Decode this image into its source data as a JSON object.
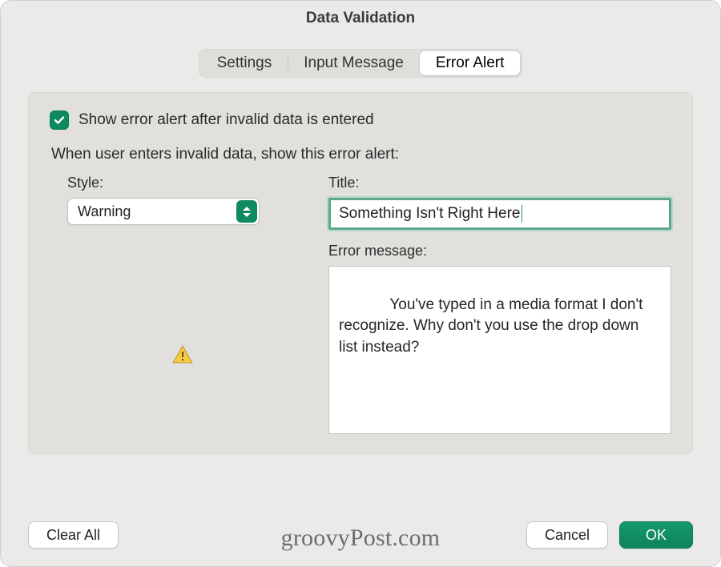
{
  "title": "Data Validation",
  "tabs": {
    "settings": "Settings",
    "input_message": "Input Message",
    "error_alert": "Error Alert",
    "active": "error_alert"
  },
  "checkbox": {
    "checked": true,
    "label": "Show error alert after invalid data is entered"
  },
  "prompt": "When user enters invalid data, show this error alert:",
  "style": {
    "label": "Style:",
    "value": "Warning"
  },
  "title_field": {
    "label": "Title:",
    "value": "Something Isn't Right Here"
  },
  "message": {
    "label": "Error message:",
    "value": "You've typed in a media format I don't recognize. Why don't you use the drop down list instead?"
  },
  "buttons": {
    "clear_all": "Clear All",
    "cancel": "Cancel",
    "ok": "OK"
  },
  "watermark": "groovyPost.com",
  "colors": {
    "accent": "#0f8a5f"
  }
}
